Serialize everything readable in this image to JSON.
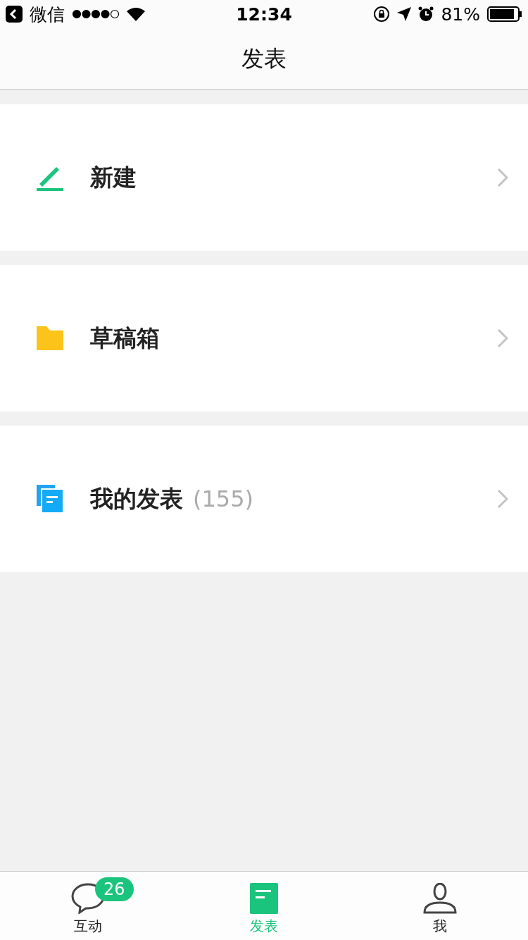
{
  "status_bar": {
    "back_app": "微信",
    "time": "12:34",
    "battery": "81%"
  },
  "nav_bar": {
    "title": "发表"
  },
  "menu": [
    {
      "kind": "new",
      "label": "新建"
    },
    {
      "kind": "drafts",
      "label": "草稿箱"
    },
    {
      "kind": "posts",
      "label": "我的发表",
      "count": "(155)"
    }
  ],
  "tab_bar": [
    {
      "kind": "chat",
      "label": "互动",
      "badge": "26",
      "selected": false
    },
    {
      "kind": "doc",
      "label": "发表",
      "selected": true
    },
    {
      "kind": "person",
      "label": "我",
      "selected": false
    }
  ]
}
